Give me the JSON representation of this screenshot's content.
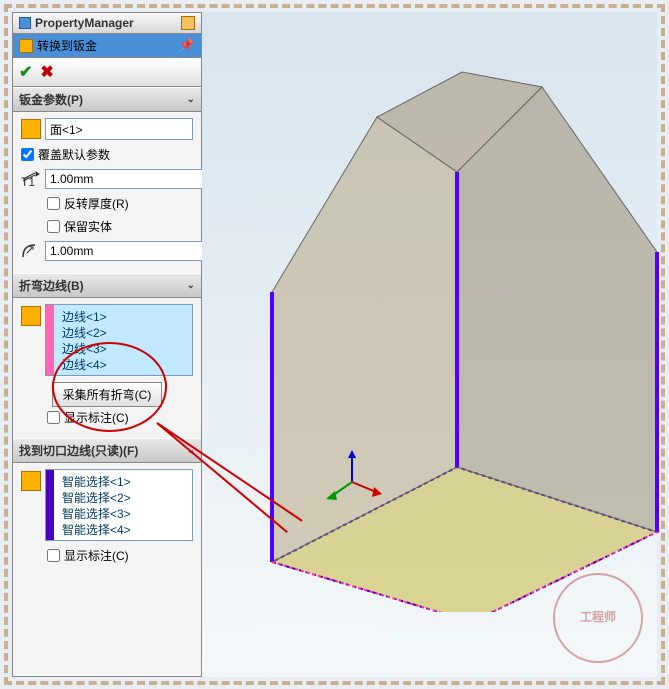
{
  "header": {
    "title": "PropertyManager"
  },
  "feature": {
    "title": "转换到钣金"
  },
  "sections": {
    "params": {
      "title": "钣金参数(P)",
      "face_field": "面<1>",
      "override_label": "覆盖默认参数",
      "override_checked": true,
      "thickness_value": "1.00mm",
      "reverse_label": "反转厚度(R)",
      "reverse_checked": false,
      "keep_body_label": "保留实体",
      "keep_body_checked": false,
      "radius_value": "1.00mm"
    },
    "bends": {
      "title": "折弯边线(B)",
      "items": [
        "边线<1>",
        "边线<2>",
        "边线<3>",
        "边线<4>"
      ],
      "collect_button": "采集所有折弯(C)",
      "callout_label": "显示标注(C)",
      "callout_checked": false
    },
    "rips": {
      "title": "找到切口边线(只读)(F)",
      "items": [
        "智能选择<1>",
        "智能选择<2>",
        "智能选择<3>",
        "智能选择<4>"
      ],
      "callout_label": "显示标注(C)",
      "callout_checked": false
    }
  },
  "watermark": "工程师"
}
